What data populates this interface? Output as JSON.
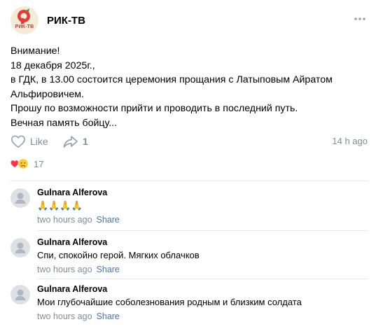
{
  "post": {
    "group_name": "РИК-ТВ",
    "logo_text": "РИК-ТВ",
    "text": "Внимание!\n18 декабря 2025г.,\nв ГДК, в 13.00 состоится церемония прощания с Латыповым Айратом Альфировичем.\nПрошу по возможности прийти и проводить в последний путь.\nВечная память бойцу...",
    "like_label": "Like",
    "share_count": "1",
    "time": "14 h ago",
    "reactions_count": "17"
  },
  "comments": [
    {
      "author": "Gulnara Alferova",
      "text": "🙏🙏🙏🙏",
      "time": "two hours ago",
      "share_label": "Share"
    },
    {
      "author": "Gulnara Alferova",
      "text": "Спи, спокойно герой. Мягких облачков",
      "time": "two hours ago",
      "share_label": "Share"
    },
    {
      "author": "Gulnara Alferova",
      "text": "Мои глубочайшие соболезнования родным и близким солдата",
      "time": "two hours ago",
      "share_label": "Share"
    }
  ],
  "colors": {
    "accent": "#4a76a8",
    "secondary_text": "#818c99",
    "divider": "#e7e8ec",
    "logo_red": "#e53935"
  },
  "icons": {
    "more": "more-horizontal-icon",
    "like": "heart-outline-icon",
    "share": "share-arrow-icon",
    "reaction_1": "heart-reaction-icon",
    "reaction_2": "sad-face-reaction-icon",
    "avatar": "default-user-avatar-icon"
  }
}
